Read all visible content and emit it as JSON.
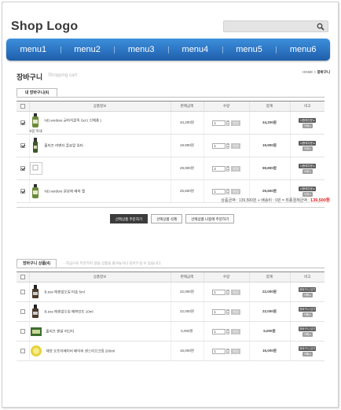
{
  "header": {
    "logo": "Shop Logo",
    "search_placeholder": "",
    "icons": {
      "search": "search-icon"
    }
  },
  "nav": [
    "menu1",
    "menu2",
    "menu3",
    "menu4",
    "menu5",
    "menu6"
  ],
  "page": {
    "title": "장바구니",
    "subtitle": "Shopping cart",
    "breadcrumb_home": "HOME",
    "breadcrumb_sep": ">",
    "breadcrumb_current": "장바구니"
  },
  "cart": {
    "tab": "내 장바구니(4)",
    "headers": [
      "",
      "상품정보",
      "판매금액",
      "수량",
      "합계",
      "비고"
    ],
    "change_label": "변경",
    "order_label": "나중에주문 ▸",
    "delete_label": "삭제 ▸",
    "rows": [
      {
        "checked": true,
        "name": "ND.verdure 글라치클릭 Gel ( 신제품 )",
        "sub": "5일 이내",
        "price": "34,200원",
        "qty": "1",
        "total": "34,200원",
        "thumb": "bottle"
      },
      {
        "checked": true,
        "name": "홀리즈 라벤더 플로랄 워터",
        "sub": "",
        "price": "19,900원",
        "qty": "1",
        "total": "19,900원",
        "thumb": "spray"
      },
      {
        "checked": true,
        "name": "",
        "sub": "",
        "price": "29,900원",
        "qty": "2",
        "total": "59,800원",
        "thumb": "broken"
      },
      {
        "checked": true,
        "name": "ND.verdure 알로에 베라 젤",
        "sub": "",
        "price": "25,600원",
        "qty": "1",
        "total": "25,600원",
        "thumb": "bottle"
      }
    ],
    "summary_label": "상품금액 : 139,500원 + 배송비 : 0원 = 최종결제금액 : ",
    "summary_total": "139,500원",
    "actions": [
      "선택상품 주문하기",
      "선택상품 삭제",
      "선택상품 나중에 주문하기"
    ]
  },
  "later": {
    "tab": "장바구니 상품(4)",
    "note": "- 지금으로 주문하지 않을 상품을 즐겨놓거나 담아두실 수 있습니다.",
    "headers": [
      "",
      "상품정보",
      "판매금액",
      "수량",
      "합계",
      "비고"
    ],
    "change_label": "변경",
    "cart_label": "장바구니 담기 ▸",
    "delete_label": "삭제 ▸",
    "rows": [
      {
        "name": "B.ess 에센셜오일 티솔 5ml",
        "price": "22,000원",
        "qty": "1",
        "total": "22,000원",
        "thumb": "dropper"
      },
      {
        "name": "B.ess 에센셜오일 페퍼민트 10ml",
        "price": "22,000원",
        "qty": "1",
        "total": "22,000원",
        "thumb": "dropper"
      },
      {
        "name": "홀리즈 헨넬 허브티",
        "price": "5,000원",
        "qty": "1",
        "total": "5,000원",
        "thumb": "box"
      },
      {
        "name": "해양 호프어베이비 베이비 센스티브크림 200ml",
        "price": "16,000원",
        "qty": "1",
        "total": "16,000원",
        "thumb": "jar"
      }
    ]
  },
  "colors": {
    "nav": "#2c74c2",
    "accent_red": "#e02020"
  }
}
